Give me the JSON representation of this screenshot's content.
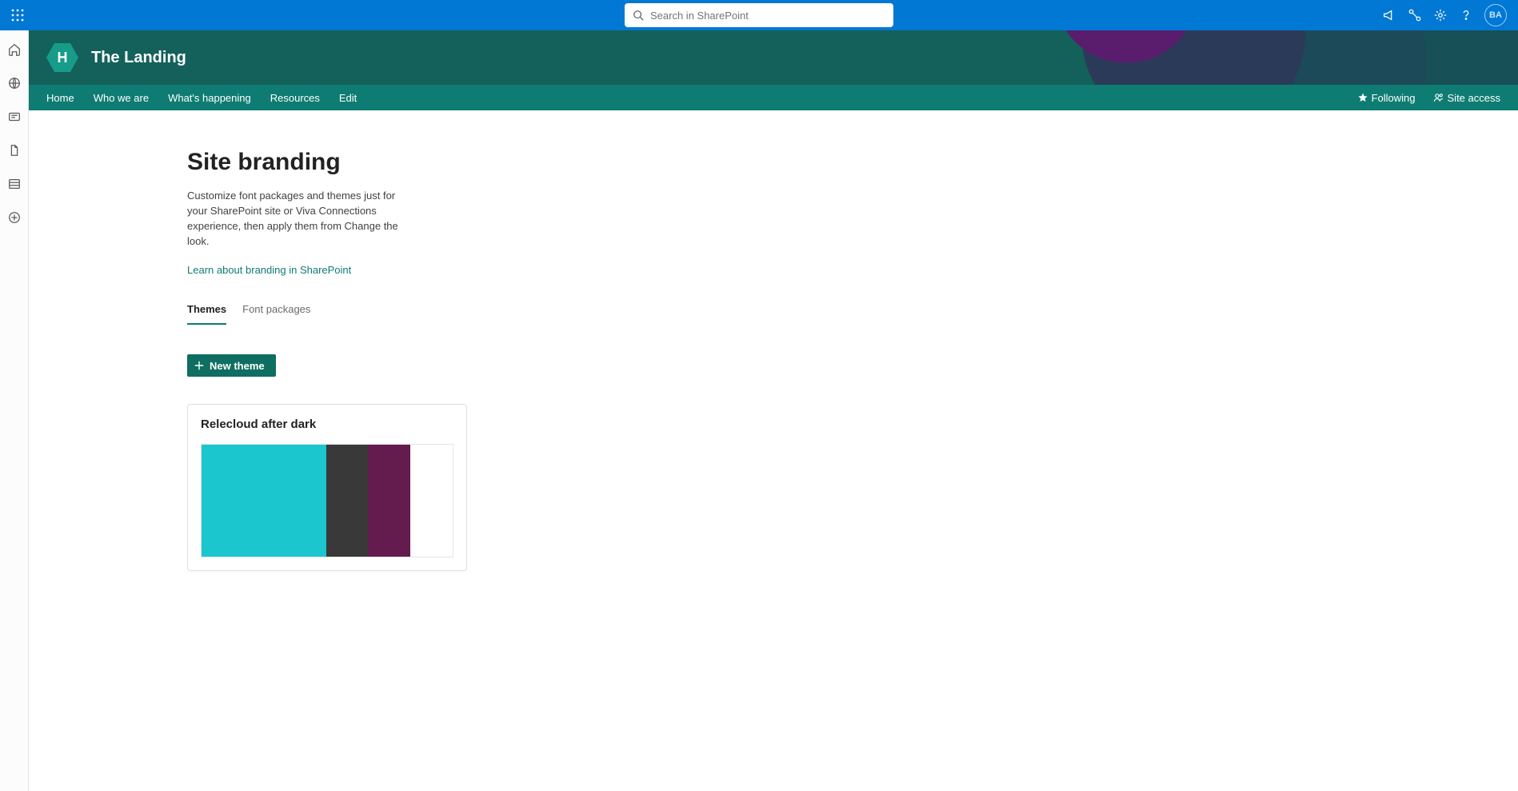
{
  "topbar": {
    "search_placeholder": "Search in SharePoint",
    "avatar_initials": "BA"
  },
  "site": {
    "logo_letter": "H",
    "title": "The Landing",
    "nav": [
      "Home",
      "Who we are",
      "What's happening",
      "Resources",
      "Edit"
    ],
    "following_label": "Following",
    "site_access_label": "Site access"
  },
  "page": {
    "title": "Site branding",
    "description": "Customize font packages and themes just for your SharePoint site or Viva Connections experience, then apply them from Change the look.",
    "learn_link": "Learn about branding in SharePoint",
    "tabs": [
      "Themes",
      "Font packages"
    ],
    "new_theme_label": "New theme",
    "theme": {
      "name": "Relecloud after dark",
      "colors": [
        "#1bc6cf",
        "#393939",
        "#641c4e",
        "#ffffff"
      ]
    }
  }
}
